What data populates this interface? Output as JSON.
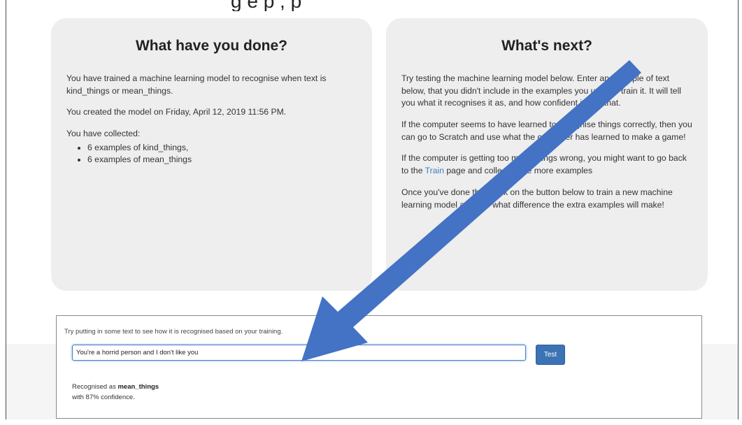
{
  "caption": "g  e    p  ,        p",
  "left_panel": {
    "title": "What have you done?",
    "para1": "You have trained a machine learning model to recognise when text is kind_things or mean_things.",
    "para2": "You created the model on Friday, April 12, 2019 11:56 PM.",
    "collected_label": "You have collected:",
    "items": [
      "6 examples of kind_things,",
      "6 examples of mean_things"
    ]
  },
  "right_panel": {
    "title": "What's next?",
    "para1": "Try testing the machine learning model below. Enter an example of text below, that you didn't include in the examples you used to train it. It will tell you what it recognises it as, and how confident it is in that.",
    "para2": "If the computer seems to have learned to recognise things correctly, then you can go to Scratch and use what the computer has learned to make a game!",
    "para3_before": "If the computer is getting too many things wrong, you might want to go back to the ",
    "para3_link": "Train",
    "para3_after": " page and collect some more examples",
    "para4": "Once you've done that, click on the button below to train a new machine learning model and see what difference the extra examples will make!"
  },
  "test": {
    "prompt": "Try putting in some text to see how it is recognised based on your training.",
    "input_value": "You're a horrid person and I don't like you",
    "button_label": "Test",
    "result_prefix": "Recognised as ",
    "result_label": "mean_things",
    "confidence_text": "with 87% confidence."
  },
  "colors": {
    "arrow": "#4472c4",
    "panel_bg": "#eeeeee",
    "button": "#3b73b5"
  }
}
